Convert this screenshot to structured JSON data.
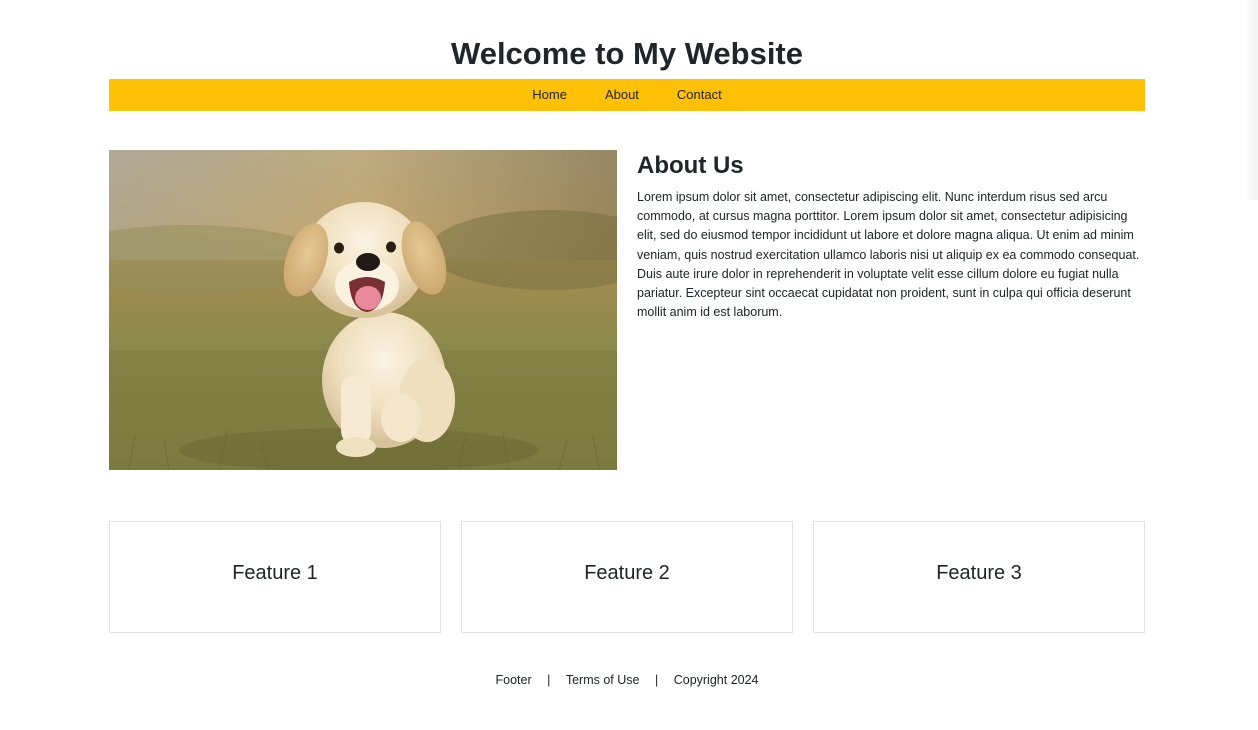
{
  "header": {
    "title": "Welcome to My Website"
  },
  "nav": {
    "items": [
      {
        "label": "Home"
      },
      {
        "label": "About"
      },
      {
        "label": "Contact"
      }
    ]
  },
  "about": {
    "heading": "About Us",
    "body": "Lorem ipsum dolor sit amet, consectetur adipiscing elit. Nunc interdum risus sed arcu commodo, at cursus magna porttitor. Lorem ipsum dolor sit amet, consectetur adipisicing elit, sed do eiusmod tempor incididunt ut labore et dolore magna aliqua. Ut enim ad minim veniam, quis nostrud exercitation ullamco laboris nisi ut aliquip ex ea commodo consequat. Duis aute irure dolor in reprehenderit in voluptate velit esse cillum dolore eu fugiat nulla pariatur. Excepteur sint occaecat cupidatat non proident, sunt in culpa qui officia deserunt mollit anim id est laborum."
  },
  "features": [
    {
      "title": "Feature 1"
    },
    {
      "title": "Feature 2"
    },
    {
      "title": "Feature 3"
    }
  ],
  "footer": {
    "label": "Footer",
    "separator": "|",
    "terms": "Terms of Use",
    "copyright": "Copyright 2024"
  },
  "colors": {
    "nav_background": "#ffc107",
    "text": "#212529",
    "card_border": "#dee2e6"
  },
  "image": {
    "subject": "puppy-photo"
  }
}
